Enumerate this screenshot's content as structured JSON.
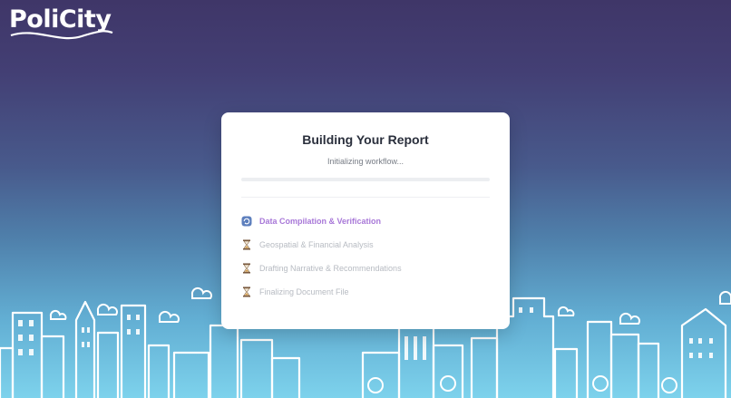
{
  "brand": {
    "name": "PoliCity"
  },
  "report": {
    "title": "Building Your Report",
    "status": "Initializing workflow...",
    "progress": 0
  },
  "steps": [
    {
      "label": "Data Compilation & Verification",
      "state": "active",
      "icon": "refresh-icon"
    },
    {
      "label": "Geospatial & Financial Analysis",
      "state": "pending",
      "icon": "hourglass-icon"
    },
    {
      "label": "Drafting Narrative & Recommendations",
      "state": "pending",
      "icon": "hourglass-icon"
    },
    {
      "label": "Finalizing Document File",
      "state": "pending",
      "icon": "hourglass-icon"
    }
  ],
  "colors": {
    "accent": "#a878d8",
    "pending_text": "#b7bbc2"
  }
}
